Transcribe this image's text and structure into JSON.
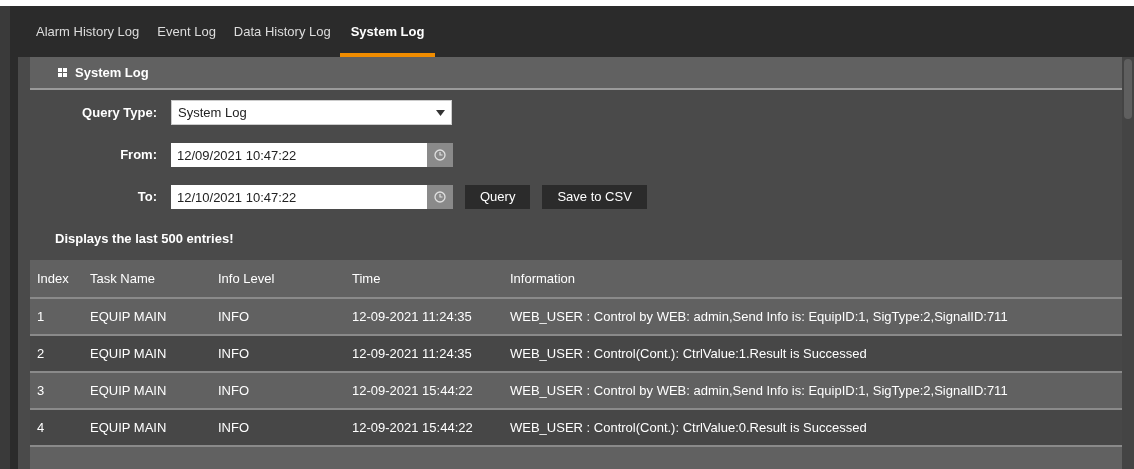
{
  "tabs": [
    {
      "label": "Alarm History Log",
      "selected": false
    },
    {
      "label": "Event Log",
      "selected": false
    },
    {
      "label": "Data History Log",
      "selected": false
    },
    {
      "label": "System Log",
      "selected": true
    }
  ],
  "panel": {
    "title": "System Log"
  },
  "form": {
    "query_type": {
      "label": "Query Type:",
      "value": "System Log"
    },
    "from": {
      "label": "From:",
      "value": "12/09/2021 10:47:22"
    },
    "to": {
      "label": "To:",
      "value": "12/10/2021 10:47:22"
    },
    "buttons": [
      "Query",
      "Save to CSV"
    ],
    "note": "Displays the last 500 entries!"
  },
  "table": {
    "columns": [
      "Index",
      "Task Name",
      "Info Level",
      "Time",
      "Information"
    ],
    "rows": [
      [
        "1",
        "EQUIP MAIN",
        "INFO",
        "12-09-2021 11:24:35",
        "WEB_USER : Control by WEB: admin,Send Info is: EquipID:1, SigType:2,SignalID:711"
      ],
      [
        "2",
        "EQUIP MAIN",
        "INFO",
        "12-09-2021 11:24:35",
        "WEB_USER : Control(Cont.): CtrlValue:1.Result is Successed"
      ],
      [
        "3",
        "EQUIP MAIN",
        "INFO",
        "12-09-2021 15:44:22",
        "WEB_USER : Control by WEB: admin,Send Info is: EquipID:1, SigType:2,SignalID:711"
      ],
      [
        "4",
        "EQUIP MAIN",
        "INFO",
        "12-09-2021 15:44:22",
        "WEB_USER : Control(Cont.): CtrlValue:0.Result is Successed"
      ]
    ]
  }
}
